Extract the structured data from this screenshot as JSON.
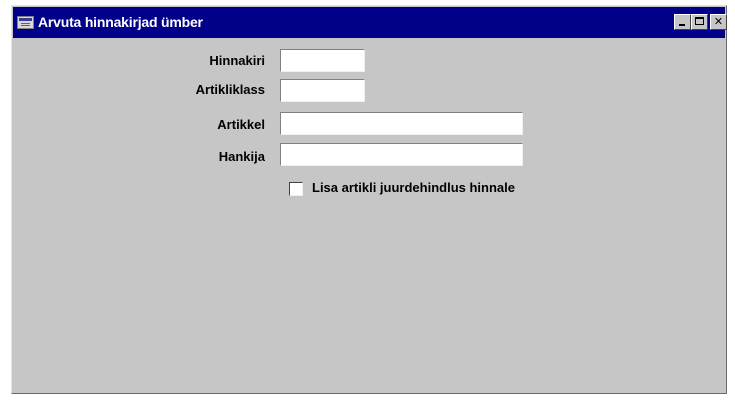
{
  "window": {
    "title": "Arvuta hinnakirjad ümber",
    "icon": "app-window-icon",
    "controls": {
      "minimize": "minimize-icon",
      "maximize": "maximize-icon",
      "close_glyph": "✕"
    }
  },
  "form": {
    "fields": [
      {
        "label": "Hinnakiri",
        "value": ""
      },
      {
        "label": "Artikliklass",
        "value": ""
      },
      {
        "label": "Artikkel",
        "value": ""
      },
      {
        "label": "Hankija",
        "value": ""
      }
    ],
    "checkbox": {
      "label": "Lisa artikli juurdehindlus hinnale",
      "checked": false
    }
  }
}
